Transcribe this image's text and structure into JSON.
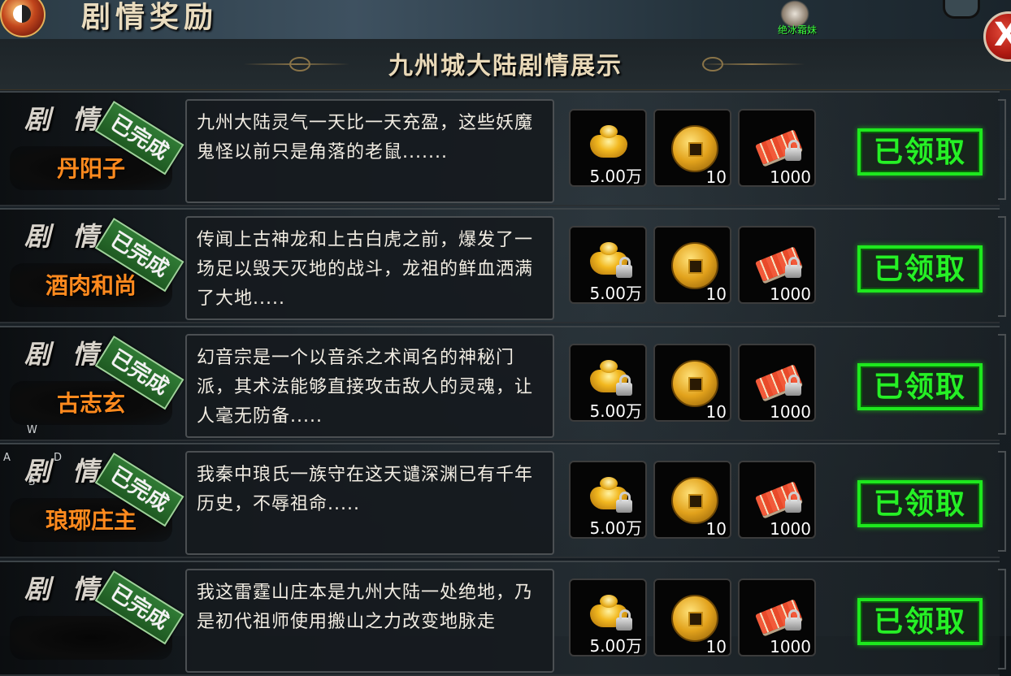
{
  "window": {
    "title": "剧情奖励",
    "top_char_name": "绝冰霜妹",
    "close_label": "X"
  },
  "panel": {
    "title": "九州城大陆剧情展示"
  },
  "row_labels": {
    "story_label": "剧 情:",
    "completed_stamp": "已完成",
    "claim_button": "已领取"
  },
  "rewards": {
    "gold_qty": "5.00万",
    "coin_qty": "10",
    "scroll_qty": "1000",
    "icons": [
      "gold-ingot-icon",
      "copper-coin-icon",
      "talisman-scroll-icon"
    ]
  },
  "rows": [
    {
      "npc": "丹阳子",
      "text": "九州大陆灵气一天比一天充盈，这些妖魔鬼怪以前只是角落的老鼠......."
    },
    {
      "npc": "酒肉和尚",
      "text": "传闻上古神龙和上古白虎之前，爆发了一场足以毁天灭地的战斗，龙祖的鲜血洒满了大地....."
    },
    {
      "npc": "古志玄",
      "text": "幻音宗是一个以音杀之术闻名的神秘门派，其术法能够直接攻击敌人的灵魂，让人毫无防备....."
    },
    {
      "npc": "琅琊庄主",
      "text": "我秦中琅氏一族守在这天谴深渊已有千年历史，不辱祖命....."
    },
    {
      "npc": "",
      "text": "我这雷霆山庄本是九州大陆一处绝地，乃是初代祖师使用搬山之力改变地脉走"
    }
  ],
  "wasd": {
    "w": "W",
    "a": "A",
    "d": "D",
    "s": "S"
  },
  "colors": {
    "npc_name": "#ff8a1e",
    "claim_green": "#1ee81e",
    "stamp_green": "#2f7a34",
    "title_text": "#e9d9b8"
  }
}
